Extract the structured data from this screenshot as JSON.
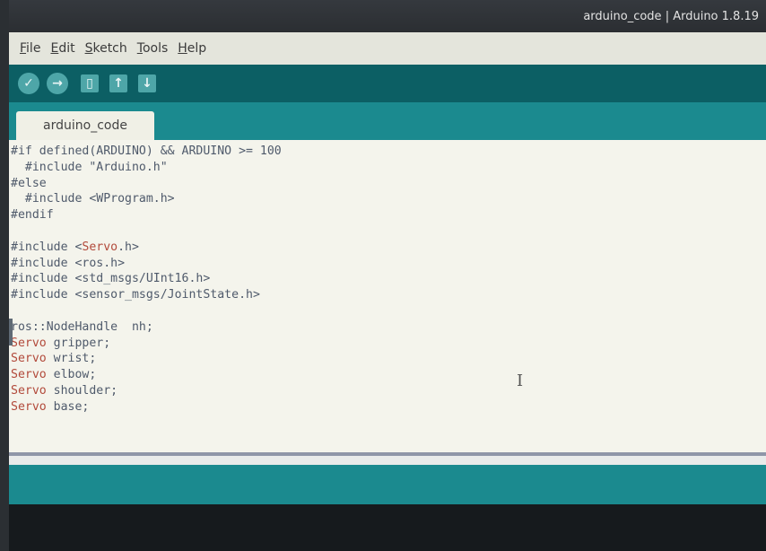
{
  "window": {
    "title": "arduino_code | Arduino 1.8.19"
  },
  "menu": [
    {
      "before": "",
      "acc": "F",
      "after": "ile"
    },
    {
      "before": "",
      "acc": "E",
      "after": "dit"
    },
    {
      "before": "",
      "acc": "S",
      "after": "ketch"
    },
    {
      "before": "",
      "acc": "T",
      "after": "ools"
    },
    {
      "before": "",
      "acc": "H",
      "after": "elp"
    }
  ],
  "toolbar": {
    "verify_icon": "✓",
    "upload_icon": "→",
    "new_icon": "▯",
    "open_icon": "↑",
    "save_icon": "↓"
  },
  "tabs": [
    {
      "label": "arduino_code"
    }
  ],
  "code_lines": [
    "#if defined(ARDUINO) && ARDUINO >= 100",
    "  #include \"Arduino.h\"",
    "#else",
    "  #include <WProgram.h>",
    "#endif",
    "",
    "#include <Servo.h>",
    "#include <ros.h>",
    "#include <std_msgs/UInt16.h>",
    "#include <sensor_msgs/JointState.h>",
    "",
    "ros::NodeHandle  nh;",
    "Servo gripper;",
    "Servo wrist;",
    "Servo elbow;",
    "Servo shoulder;",
    "Servo base;"
  ],
  "keywords": [
    "Servo"
  ],
  "colors": {
    "toolbar": "#0c5f64",
    "tabbar": "#1b8a8f",
    "editor_bg": "#f4f4ec",
    "keyword": "#b24a3b",
    "code_text": "#4f5a6b"
  }
}
